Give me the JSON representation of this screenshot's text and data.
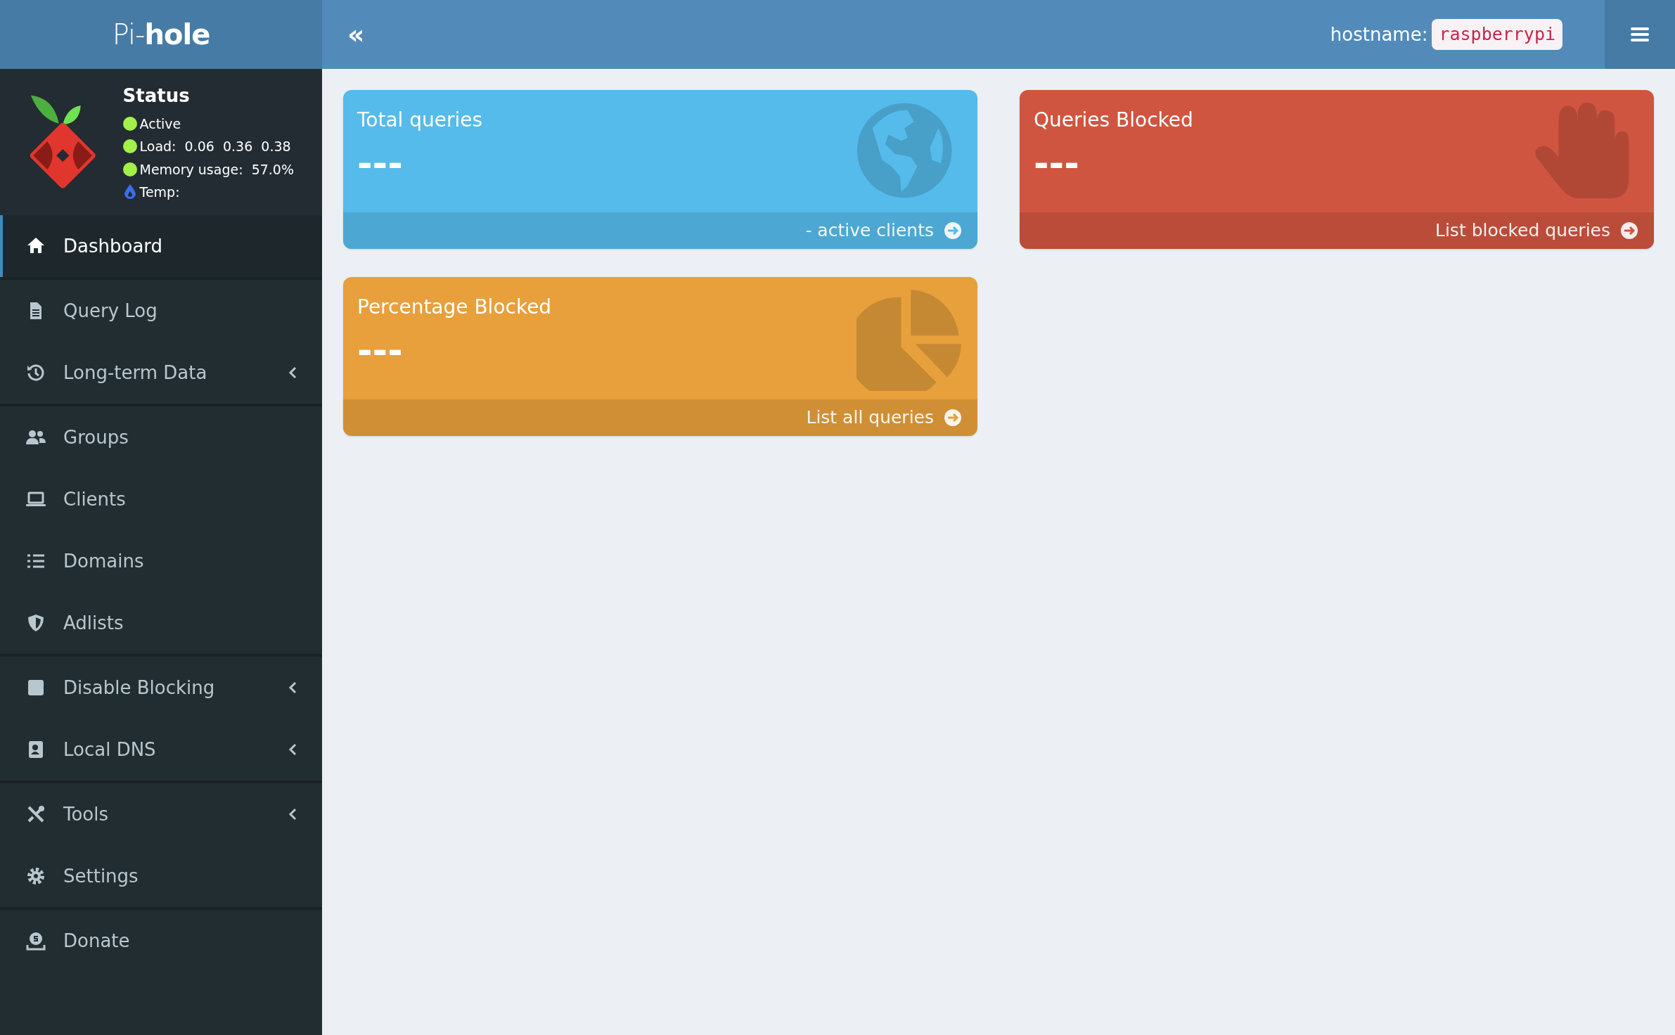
{
  "brand": {
    "light": "Pi-",
    "bold": "hole"
  },
  "header": {
    "collapse_icon": "«",
    "hostname_label": "hostname:",
    "hostname": "raspberrypi"
  },
  "status": {
    "title": "Status",
    "lines": [
      {
        "kind": "dot",
        "color": "#a3f04b",
        "text": "Active"
      },
      {
        "kind": "dot",
        "color": "#a3f04b",
        "text": "Load:  0.06  0.36  0.38"
      },
      {
        "kind": "dot",
        "color": "#a3f04b",
        "text": "Memory usage:  57.0%"
      },
      {
        "kind": "flame",
        "color": "#3b6ff0",
        "text": "Temp:"
      }
    ]
  },
  "sidebar": {
    "groups": [
      [
        {
          "label": "Dashboard",
          "selected": true,
          "expandable": false
        }
      ],
      [
        {
          "label": "Query Log",
          "selected": false,
          "expandable": false
        },
        {
          "label": "Long-term Data",
          "selected": false,
          "expandable": true
        }
      ],
      [
        {
          "label": "Groups",
          "selected": false,
          "expandable": false
        },
        {
          "label": "Clients",
          "selected": false,
          "expandable": false
        },
        {
          "label": "Domains",
          "selected": false,
          "expandable": false
        },
        {
          "label": "Adlists",
          "selected": false,
          "expandable": false
        }
      ],
      [
        {
          "label": "Disable Blocking",
          "selected": false,
          "expandable": true
        },
        {
          "label": "Local DNS",
          "selected": false,
          "expandable": true
        }
      ],
      [
        {
          "label": "Tools",
          "selected": false,
          "expandable": true
        },
        {
          "label": "Settings",
          "selected": false,
          "expandable": false
        }
      ],
      [
        {
          "label": "Donate",
          "selected": false,
          "expandable": false
        }
      ]
    ]
  },
  "cards": [
    {
      "title": "Total queries",
      "value": "---",
      "footer": "- active clients",
      "color": "#55bbea"
    },
    {
      "title": "Queries Blocked",
      "value": "---",
      "footer": "List blocked queries",
      "color": "#d05540"
    },
    {
      "title": "Percentage Blocked",
      "value": "---",
      "footer": "List all queries",
      "color": "#e8a03c"
    }
  ]
}
